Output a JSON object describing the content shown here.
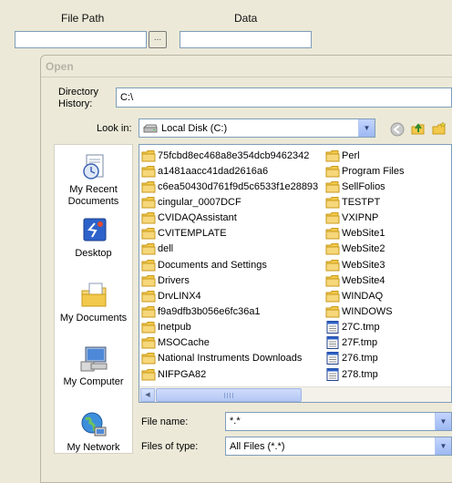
{
  "form": {
    "file_path_label": "File Path",
    "data_label": "Data",
    "file_path_value": "",
    "data_value": "",
    "browse_label": "..."
  },
  "dialog": {
    "title": "Open",
    "directory_history_label": "Directory History:",
    "directory_history_value": "C:\\",
    "look_in_label": "Look in:",
    "look_in_value": "Local Disk (C:)",
    "toolbar": [
      "back-icon",
      "up-folder-icon",
      "new-folder-icon"
    ],
    "places": [
      {
        "label": "My Recent Documents",
        "icon": "recent-documents-icon"
      },
      {
        "label": "Desktop",
        "icon": "desktop-icon"
      },
      {
        "label": "My Documents",
        "icon": "my-documents-icon"
      },
      {
        "label": "My Computer",
        "icon": "my-computer-icon"
      },
      {
        "label": "My Network",
        "icon": "my-network-icon"
      }
    ],
    "files_col1": [
      {
        "name": "75fcbd8ec468a8e354dcb9462342",
        "type": "folder"
      },
      {
        "name": "a1481aacc41dad2616a6",
        "type": "folder"
      },
      {
        "name": "c6ea50430d761f9d5c6533f1e28893",
        "type": "folder"
      },
      {
        "name": "cingular_0007DCF",
        "type": "folder"
      },
      {
        "name": "CVIDAQAssistant",
        "type": "folder"
      },
      {
        "name": "CVITEMPLATE",
        "type": "folder"
      },
      {
        "name": "dell",
        "type": "folder"
      },
      {
        "name": "Documents and Settings",
        "type": "folder"
      },
      {
        "name": "Drivers",
        "type": "folder"
      },
      {
        "name": "DrvLINX4",
        "type": "folder"
      },
      {
        "name": "f9a9dfb3b056e6fc36a1",
        "type": "folder"
      },
      {
        "name": "Inetpub",
        "type": "folder"
      },
      {
        "name": "MSOCache",
        "type": "folder"
      },
      {
        "name": "National Instruments Downloads",
        "type": "folder"
      },
      {
        "name": "NIFPGA82",
        "type": "folder"
      }
    ],
    "files_col2": [
      {
        "name": "Perl",
        "type": "folder"
      },
      {
        "name": "Program Files",
        "type": "folder"
      },
      {
        "name": "SellFolios",
        "type": "folder"
      },
      {
        "name": "TESTPT",
        "type": "folder"
      },
      {
        "name": "VXIPNP",
        "type": "folder"
      },
      {
        "name": "WebSite1",
        "type": "folder"
      },
      {
        "name": "WebSite2",
        "type": "folder"
      },
      {
        "name": "WebSite3",
        "type": "folder"
      },
      {
        "name": "WebSite4",
        "type": "folder"
      },
      {
        "name": "WINDAQ",
        "type": "folder"
      },
      {
        "name": "WINDOWS",
        "type": "folder"
      },
      {
        "name": "27C.tmp",
        "type": "file"
      },
      {
        "name": "27F.tmp",
        "type": "file"
      },
      {
        "name": "276.tmp",
        "type": "file"
      },
      {
        "name": "278.tmp",
        "type": "file"
      }
    ],
    "file_name_label": "File name:",
    "file_name_value": "*.*",
    "files_of_type_label": "Files of type:",
    "files_of_type_value": "All Files (*.*)"
  },
  "colors": {
    "folder": "#f2c94c",
    "folder_dark": "#c89a1c",
    "dialog_bg": "#ece9d8"
  }
}
